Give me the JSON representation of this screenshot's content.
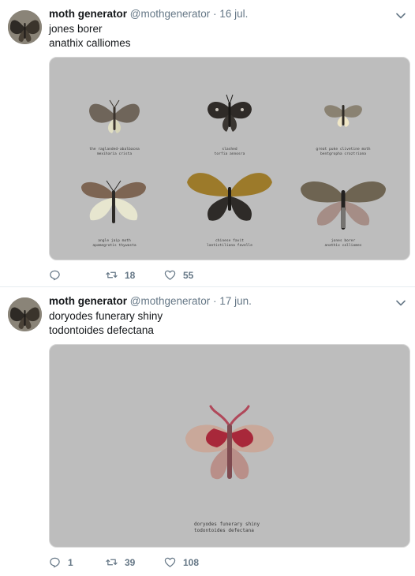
{
  "tweets": [
    {
      "name": "moth generator",
      "handle": "@mothgenerator",
      "separator": "·",
      "date": "16 jul.",
      "lines": [
        "jones borer",
        "anathix calliomes"
      ],
      "moths": [
        {
          "common": "the raglanded-abalbacea",
          "latin": "mexiharia crista"
        },
        {
          "common": "slashed",
          "latin": "torfia annosra"
        },
        {
          "common": "great puke clivetine moth",
          "latin": "bentgropha croztriana"
        },
        {
          "common": "angle jaip moth",
          "latin": "apamegrotis thywasta"
        },
        {
          "common": "chinese favit",
          "latin": "lantistiliana favelle"
        },
        {
          "common": "jones borer",
          "latin": "anathix calliomes"
        }
      ],
      "actions": {
        "reply": "",
        "retweet": "18",
        "like": "55"
      }
    },
    {
      "name": "moth generator",
      "handle": "@mothgenerator",
      "separator": "·",
      "date": "17 jun.",
      "lines": [
        "doryodes funerary shiny",
        "todontoides defectana"
      ],
      "moths": [
        {
          "common": "doryodes funerary shiny",
          "latin": "todontoides defectana"
        }
      ],
      "actions": {
        "reply": "1",
        "retweet": "39",
        "like": "108"
      }
    }
  ],
  "icons": [
    "avatar-moth",
    "chevron-down-icon",
    "reply-icon",
    "retweet-icon",
    "like-icon"
  ],
  "colors": {
    "text": "#14171a",
    "muted": "#657786",
    "media_bg": "#bdbdbd",
    "divider": "#e6ecf0"
  }
}
